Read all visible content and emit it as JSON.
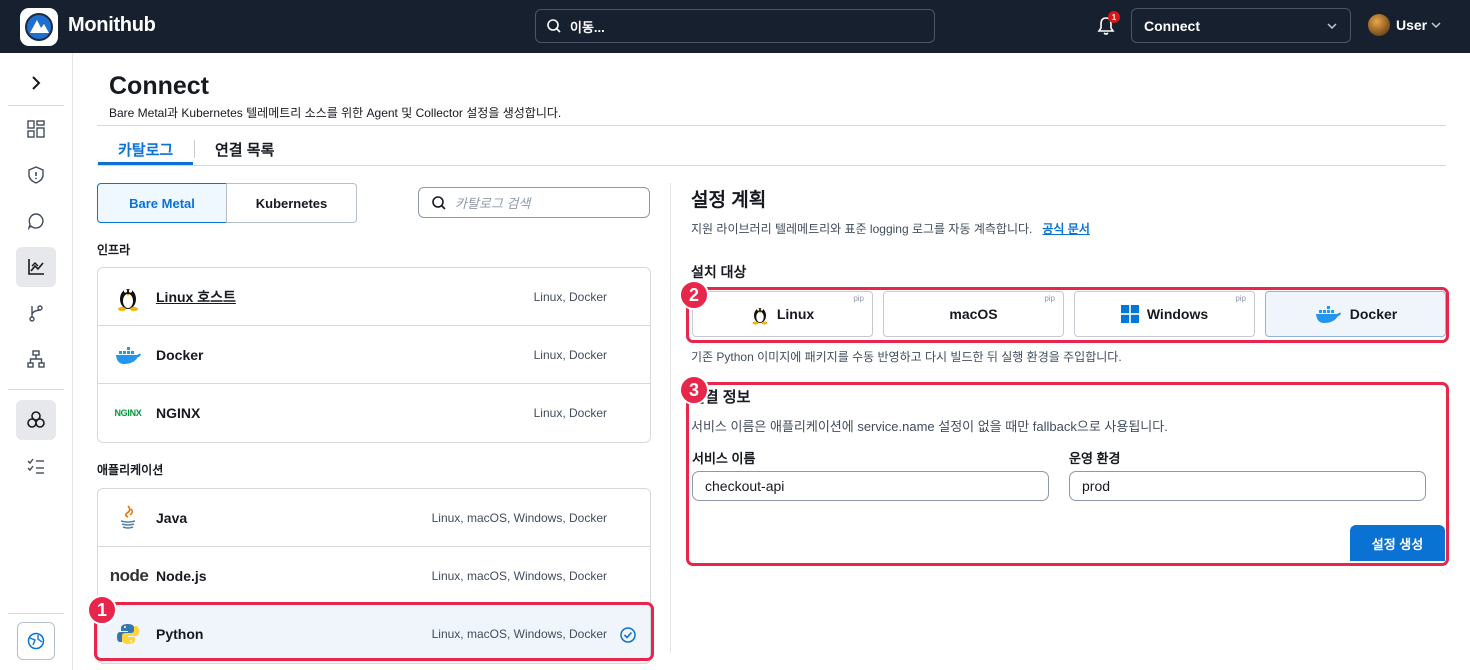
{
  "app": {
    "title": "Monithub"
  },
  "topbar": {
    "search_text": "이동...",
    "notification_count": "1",
    "connect_select_value": "Connect",
    "user_name": "User"
  },
  "page": {
    "title": "Connect",
    "description": "Bare Metal과 Kubernetes 텔레메트리 소스를 위한 Agent 및 Collector 설정을 생성합니다."
  },
  "tabs": [
    {
      "label": "카탈로그"
    },
    {
      "label": "연결 목록"
    }
  ],
  "catalog": {
    "segments": [
      "Bare Metal",
      "Kubernetes"
    ],
    "search_placeholder": "카탈로그 검색",
    "infra_label": "인프라",
    "infra": [
      {
        "name": "Linux 호스트",
        "platforms": "Linux, Docker",
        "icon": "tux-icon"
      },
      {
        "name": "Docker",
        "platforms": "Linux, Docker",
        "icon": "docker-icon"
      },
      {
        "name": "NGINX",
        "platforms": "Linux, Docker",
        "icon": "nginx-logo",
        "logo_text": "NGINX"
      }
    ],
    "apps_label": "애플리케이션",
    "apps": [
      {
        "name": "Java",
        "platforms": "Linux, macOS, Windows, Docker",
        "icon": "java-icon"
      },
      {
        "name": "Node.js",
        "platforms": "Linux, macOS, Windows, Docker",
        "icon": "nodejs-logo",
        "logo_text": "node"
      },
      {
        "name": "Python",
        "platforms": "Linux, macOS, Windows, Docker",
        "icon": "python-icon",
        "selected": true
      }
    ]
  },
  "plan": {
    "title": "설정 계획",
    "description": "지원 라이브러리 텔레메트리와 표준 logging 로그를 자동 계측합니다.",
    "docs_link": "공식 문서",
    "install_target_label": "설치 대상",
    "targets": [
      {
        "name": "Linux",
        "tag": "pip",
        "icon": "tux-icon"
      },
      {
        "name": "macOS",
        "tag": "pip"
      },
      {
        "name": "Windows",
        "tag": "pip",
        "icon": "windows-icon"
      },
      {
        "name": "Docker",
        "tag": "",
        "icon": "docker-icon",
        "selected": true
      }
    ],
    "target_note": "기존 Python 이미지에 패키지를 수동 반영하고 다시 빌드한 뒤 실행 환경을 주입합니다."
  },
  "connection": {
    "title": "연결 정보",
    "description": "서비스 이름은 애플리케이션에 service.name 설정이 없을 때만 fallback으로 사용됩니다.",
    "service_name_label": "서비스 이름",
    "service_name_value": "checkout-api",
    "env_label": "운영 환경",
    "env_value": "prod",
    "generate_button": "설정 생성"
  },
  "annotations": [
    "1",
    "2",
    "3"
  ],
  "colors": {
    "accent": "#0972d3",
    "highlight": "#e8254b",
    "topbar": "#16202f"
  }
}
